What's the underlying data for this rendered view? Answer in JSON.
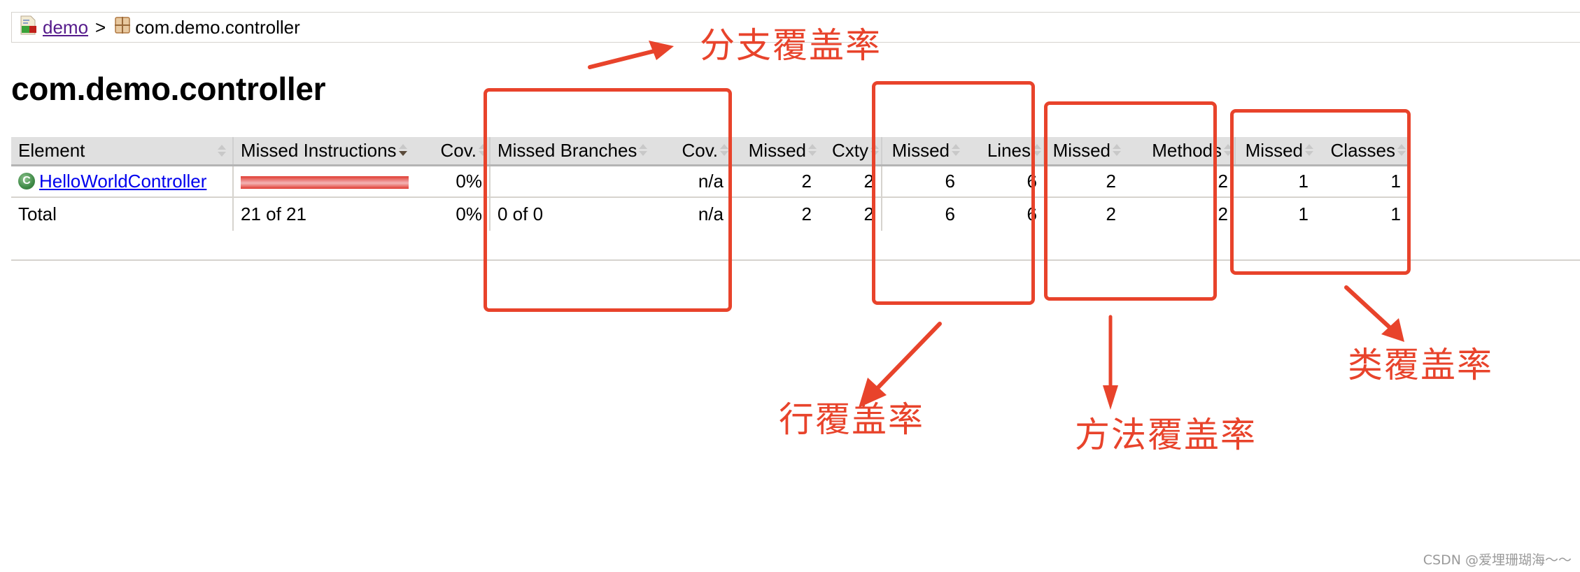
{
  "breadcrumb": {
    "items": [
      {
        "label": "demo",
        "icon": "report-icon",
        "link": true
      },
      {
        "label": "com.demo.controller",
        "icon": "package-icon",
        "link": false
      }
    ],
    "separator": ">"
  },
  "page_title": "com.demo.controller",
  "table": {
    "headers": [
      {
        "label": "Element",
        "sort": "none"
      },
      {
        "label": "Missed Instructions",
        "sort": "desc"
      },
      {
        "label": "Cov.",
        "sort": "none"
      },
      {
        "label": "Missed Branches",
        "sort": "none"
      },
      {
        "label": "Cov.",
        "sort": "none"
      },
      {
        "label": "Missed",
        "sort": "none"
      },
      {
        "label": "Cxty",
        "sort": "none"
      },
      {
        "label": "Missed",
        "sort": "none"
      },
      {
        "label": "Lines",
        "sort": "none"
      },
      {
        "label": "Missed",
        "sort": "none"
      },
      {
        "label": "Methods",
        "sort": "none"
      },
      {
        "label": "Missed",
        "sort": "none"
      },
      {
        "label": "Classes",
        "sort": "none"
      }
    ],
    "rows": [
      {
        "element": "HelloWorldController",
        "element_icon": "class-icon",
        "missed_instructions_ratio": 1.0,
        "instr_cov": "0%",
        "missed_branches": "",
        "branch_cov": "n/a",
        "missed_cxty": "2",
        "cxty": "2",
        "missed_lines": "6",
        "lines": "6",
        "missed_methods": "2",
        "methods": "2",
        "missed_classes": "1",
        "classes": "1"
      }
    ],
    "total": {
      "element": "Total",
      "missed_instructions": "21 of 21",
      "instr_cov": "0%",
      "missed_branches": "0 of 0",
      "branch_cov": "n/a",
      "missed_cxty": "2",
      "cxty": "2",
      "missed_lines": "6",
      "lines": "6",
      "missed_methods": "2",
      "methods": "2",
      "missed_classes": "1",
      "classes": "1"
    }
  },
  "annotations": {
    "color": "#e8432b",
    "branch_label": "分支覆盖率",
    "line_label": "行覆盖率",
    "method_label": "方法覆盖率",
    "class_label": "类覆盖率"
  },
  "watermark": "CSDN @爱埋珊瑚海～～"
}
